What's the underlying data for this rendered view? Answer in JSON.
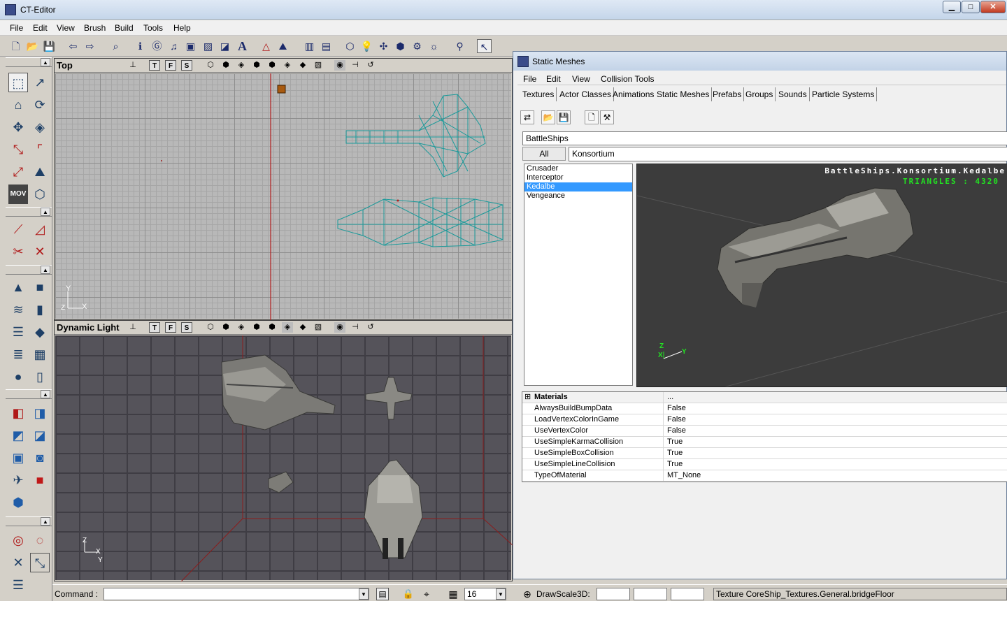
{
  "app": {
    "title": "CT-Editor"
  },
  "window_buttons": {
    "minimize": "▁",
    "maximize": "□",
    "close": "✕"
  },
  "menu": [
    "File",
    "Edit",
    "View",
    "Brush",
    "Build",
    "Tools",
    "Help"
  ],
  "viewports": {
    "top": {
      "title": "Top",
      "axis_y": "Y",
      "axis_x": "X",
      "axis_z": "Z"
    },
    "dynamic": {
      "title": "Dynamic Light",
      "axis_z": "Z",
      "axis_x": "X",
      "axis_y": "Y"
    },
    "icon_t": "T",
    "icon_f": "F",
    "icon_s": "S"
  },
  "statusbar": {
    "command_label": "Command :",
    "grid_value": "16",
    "drawscale_label": "DrawScale3D:",
    "texture_info": "Texture CoreShip_Textures.General.bridgeFloor"
  },
  "static_meshes": {
    "title": "Static Meshes",
    "menu": [
      "File",
      "Edit",
      "View",
      "Collision Tools"
    ],
    "tabs": [
      "Textures",
      "Actor Classes",
      "Animations",
      "Static Meshes",
      "Prefabs",
      "Groups",
      "Sounds",
      "Particle Systems"
    ],
    "active_tab": "Static Meshes",
    "package": "BattleShips",
    "all_button": "All",
    "group": "Konsortium",
    "meshes": [
      "Crusader",
      "Interceptor",
      "Kedalbe",
      "Vengeance"
    ],
    "selected_mesh": "Kedalbe",
    "preview": {
      "name": "BattleShips.Konsortium.Kedalbe",
      "triangles": "TRIANGLES : 4320",
      "axis_z": "Z",
      "axis_x": "X",
      "axis_y": "Y"
    },
    "properties": {
      "group_label": "Materials",
      "group_value": "...",
      "expander": "⊞",
      "rows": [
        {
          "name": "AlwaysBuildBumpData",
          "value": "False"
        },
        {
          "name": "LoadVertexColorInGame",
          "value": "False"
        },
        {
          "name": "UseVertexColor",
          "value": "False"
        },
        {
          "name": "UseSimpleKarmaCollision",
          "value": "True"
        },
        {
          "name": "UseSimpleBoxCollision",
          "value": "True"
        },
        {
          "name": "UseSimpleLineCollision",
          "value": "True"
        },
        {
          "name": "TypeOfMaterial",
          "value": "MT_None"
        }
      ]
    }
  },
  "colors": {
    "accent": "#3399ff",
    "wireframe": "#1a9a9a",
    "triangles_text": "#22e322",
    "viewport_dark": "#55535a"
  }
}
